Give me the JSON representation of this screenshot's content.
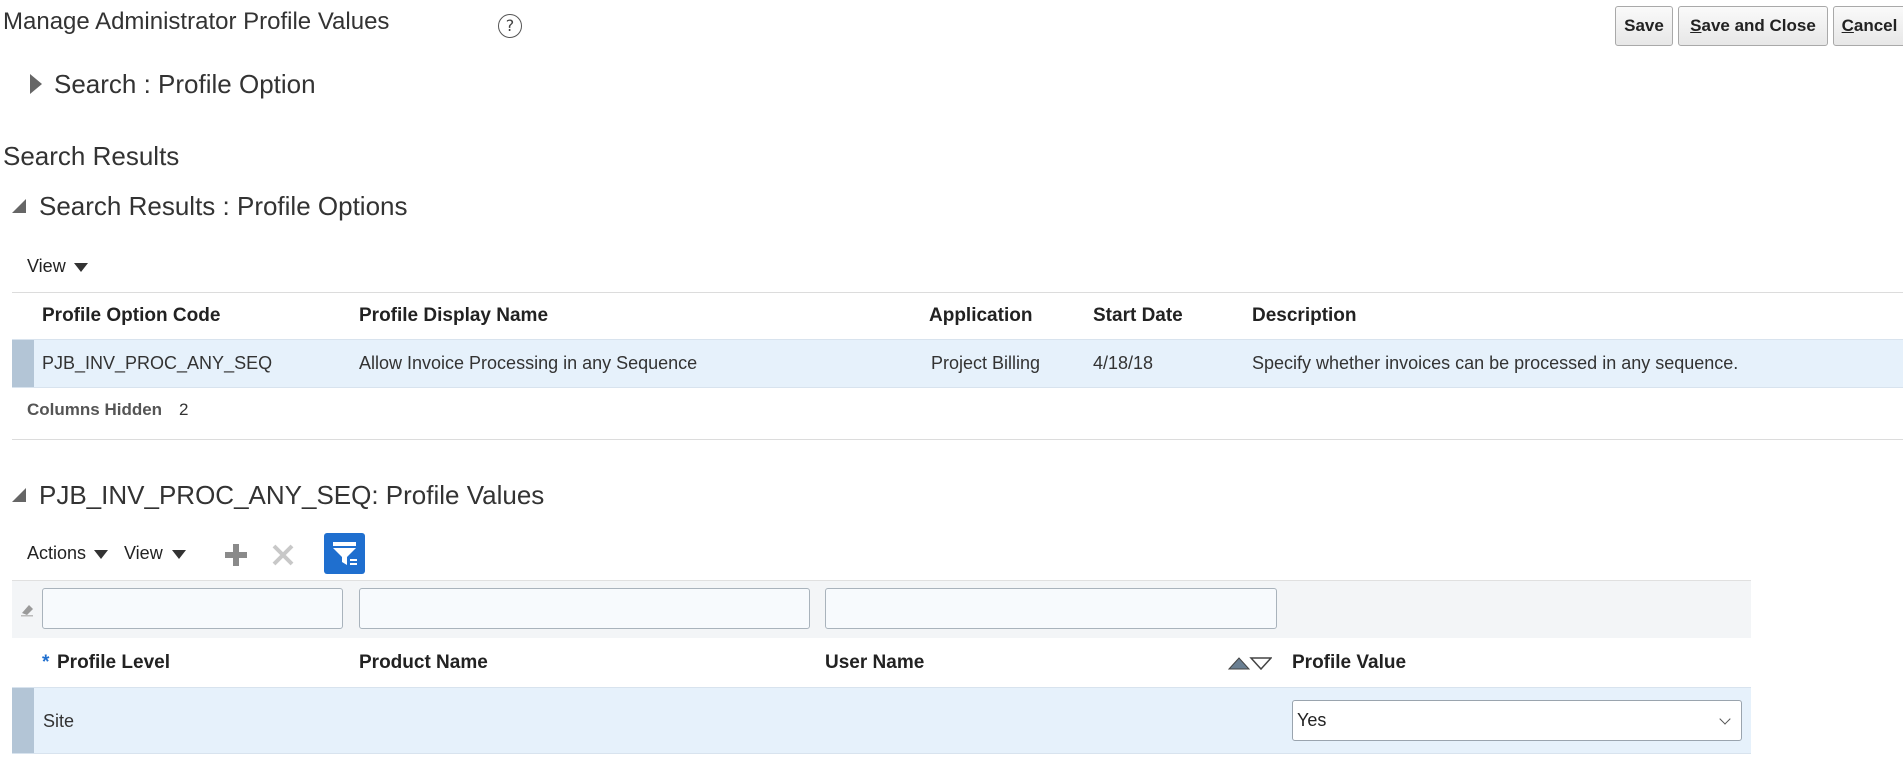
{
  "page": {
    "title": "Manage Administrator Profile Values",
    "help_icon": "?"
  },
  "toolbar": {
    "save_label": "Save",
    "save_close_prefix": "S",
    "save_close_rest": "ave and Close",
    "cancel_prefix": "C",
    "cancel_rest": "ancel"
  },
  "search": {
    "label": "Search : Profile Option"
  },
  "results": {
    "heading": "Search Results",
    "section_title": "Search Results : Profile Options",
    "view_label": "View",
    "columns": [
      "Profile Option Code",
      "Profile Display Name",
      "Application",
      "Start Date",
      "Description"
    ],
    "rows": [
      {
        "code": "PJB_INV_PROC_ANY_SEQ",
        "display_name": "Allow Invoice Processing in any Sequence",
        "application": "Project Billing",
        "start_date": "4/18/18",
        "description": "Specify whether invoices can be processed in any sequence."
      }
    ],
    "columns_hidden_label": "Columns Hidden",
    "columns_hidden_count": "2"
  },
  "values": {
    "section_title": "PJB_INV_PROC_ANY_SEQ: Profile Values",
    "actions_label": "Actions",
    "view_label": "View",
    "required_marker": "*",
    "columns": [
      "Profile Level",
      "Product Name",
      "User Name",
      "Profile Value"
    ],
    "rows": [
      {
        "profile_level": "Site",
        "product_name": "",
        "user_name": "",
        "profile_value": "Yes"
      }
    ]
  },
  "icons": {
    "help": "help-icon",
    "expand": "expand-triangle-icon",
    "collapse": "collapse-triangle-icon",
    "add": "add-icon",
    "delete": "delete-icon",
    "query_by_example": "filter-icon",
    "sort": "sort-icon",
    "clear_filter": "eraser-icon"
  },
  "colors": {
    "accent": "#1f6fcf",
    "row_selected": "#e6f1fb",
    "row_marker": "#b3c5d6"
  }
}
